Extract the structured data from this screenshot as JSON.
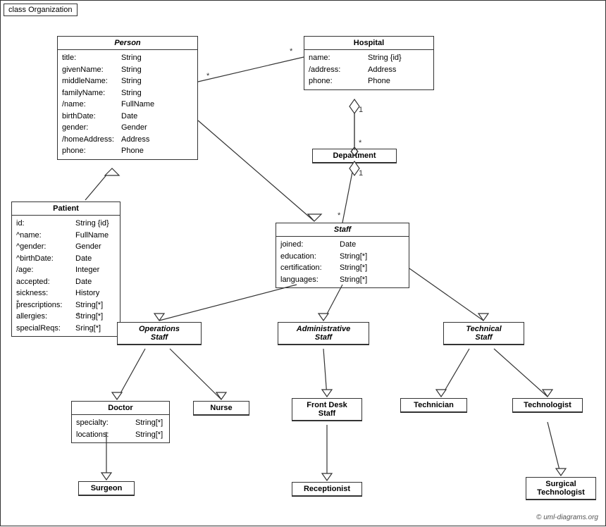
{
  "diagram": {
    "title": "class Organization",
    "footer": "© uml-diagrams.org",
    "classes": {
      "person": {
        "name": "Person",
        "italic": true,
        "attrs": [
          {
            "name": "title:",
            "type": "String"
          },
          {
            "name": "givenName:",
            "type": "String"
          },
          {
            "name": "middleName:",
            "type": "String"
          },
          {
            "name": "familyName:",
            "type": "String"
          },
          {
            "name": "/name:",
            "type": "FullName"
          },
          {
            "name": "birthDate:",
            "type": "Date"
          },
          {
            "name": "gender:",
            "type": "Gender"
          },
          {
            "name": "/homeAddress:",
            "type": "Address"
          },
          {
            "name": "phone:",
            "type": "Phone"
          }
        ]
      },
      "hospital": {
        "name": "Hospital",
        "italic": false,
        "attrs": [
          {
            "name": "name:",
            "type": "String {id}"
          },
          {
            "name": "/address:",
            "type": "Address"
          },
          {
            "name": "phone:",
            "type": "Phone"
          }
        ]
      },
      "department": {
        "name": "Department",
        "italic": false,
        "attrs": []
      },
      "staff": {
        "name": "Staff",
        "italic": true,
        "attrs": [
          {
            "name": "joined:",
            "type": "Date"
          },
          {
            "name": "education:",
            "type": "String[*]"
          },
          {
            "name": "certification:",
            "type": "String[*]"
          },
          {
            "name": "languages:",
            "type": "String[*]"
          }
        ]
      },
      "patient": {
        "name": "Patient",
        "italic": false,
        "attrs": [
          {
            "name": "id:",
            "type": "String {id}"
          },
          {
            "name": "^name:",
            "type": "FullName"
          },
          {
            "name": "^gender:",
            "type": "Gender"
          },
          {
            "name": "^birthDate:",
            "type": "Date"
          },
          {
            "name": "/age:",
            "type": "Integer"
          },
          {
            "name": "accepted:",
            "type": "Date"
          },
          {
            "name": "sickness:",
            "type": "History"
          },
          {
            "name": "prescriptions:",
            "type": "String[*]"
          },
          {
            "name": "allergies:",
            "type": "String[*]"
          },
          {
            "name": "specialReqs:",
            "type": "Sring[*]"
          }
        ]
      },
      "operations_staff": {
        "name": "Operations Staff",
        "italic": true
      },
      "administrative_staff": {
        "name": "Administrative Staff",
        "italic": true
      },
      "technical_staff": {
        "name": "Technical Staff",
        "italic": true
      },
      "doctor": {
        "name": "Doctor",
        "italic": false,
        "attrs": [
          {
            "name": "specialty:",
            "type": "String[*]"
          },
          {
            "name": "locations:",
            "type": "String[*]"
          }
        ]
      },
      "nurse": {
        "name": "Nurse",
        "italic": false,
        "attrs": []
      },
      "front_desk_staff": {
        "name": "Front Desk Staff",
        "italic": false,
        "attrs": []
      },
      "technician": {
        "name": "Technician",
        "italic": false,
        "attrs": []
      },
      "technologist": {
        "name": "Technologist",
        "italic": false,
        "attrs": []
      },
      "surgeon": {
        "name": "Surgeon",
        "italic": false,
        "attrs": []
      },
      "receptionist": {
        "name": "Receptionist",
        "italic": false,
        "attrs": []
      },
      "surgical_technologist": {
        "name": "Surgical Technologist",
        "italic": false,
        "attrs": []
      }
    }
  }
}
